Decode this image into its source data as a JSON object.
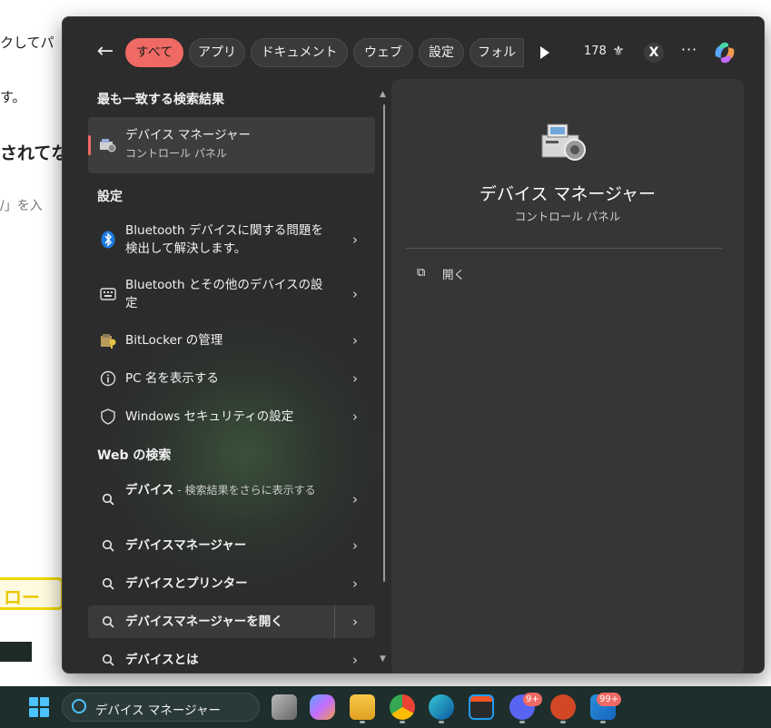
{
  "background_page": {
    "line1": "クしてパ",
    "line2": "す。",
    "line3": "されてな",
    "line4": "/」を入",
    "sign_text": "ロー"
  },
  "topbar": {
    "back_icon": "arrow-left",
    "filters": [
      "すべて",
      "アプリ",
      "ドキュメント",
      "ウェブ",
      "設定",
      "フォル"
    ],
    "active_filter": "すべて",
    "points": "178",
    "account_initial": "X",
    "more": "···"
  },
  "best_match": {
    "header": "最も一致する検索結果",
    "title": "デバイス マネージャー",
    "subtitle": "コントロール パネル"
  },
  "settings": {
    "header": "設定",
    "items": [
      {
        "label": "Bluetooth デバイスに関する問題を検出して解決します。",
        "icon": "bluetooth-icon"
      },
      {
        "label": "Bluetooth とその他のデバイスの設定",
        "icon": "keyboard-icon"
      },
      {
        "label": "BitLocker の管理",
        "icon": "bitlocker-key-icon"
      },
      {
        "label": "PC 名を表示する",
        "icon": "info-icon"
      },
      {
        "label": "Windows セキュリティの設定",
        "icon": "shield-icon"
      }
    ]
  },
  "web": {
    "header": "Web の検索",
    "items": [
      {
        "label": "デバイス",
        "sub": " - 検索結果をさらに表示する"
      },
      {
        "label": "デバイスマネージャー"
      },
      {
        "label": "デバイスとプリンター"
      },
      {
        "label": "デバイスマネージャーを開く"
      },
      {
        "label": "デバイスとは"
      }
    ]
  },
  "preview": {
    "title": "デバイス マネージャー",
    "subtitle": "コントロール パネル",
    "open_label": "開く"
  },
  "taskbar": {
    "search_text": "デバイス マネージャー",
    "discord_badge": "9+",
    "todo_badge": "99+"
  },
  "colors": {
    "accent": "#ef6a64",
    "panel": "#2c2c2c",
    "preview": "#363636",
    "taskbar": "#1d2e2c",
    "windows_blue": "#4cc2ff"
  }
}
